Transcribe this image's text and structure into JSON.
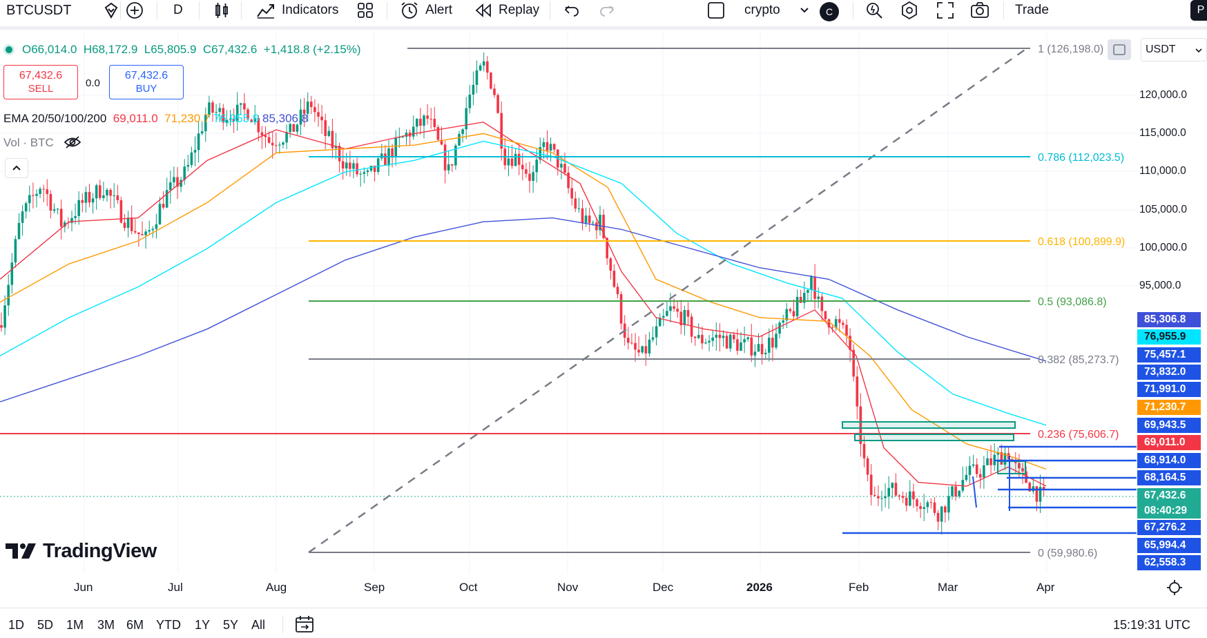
{
  "toolbar": {
    "symbol": "BTCUSDT",
    "interval": "D",
    "indicators_label": "Indicators",
    "alert_label": "Alert",
    "replay_label": "Replay",
    "layout_name": "crypto",
    "avatar_letter": "C",
    "trade_label": "Trade",
    "profile_letter": "P"
  },
  "legend": {
    "open": "O66,014.0",
    "high": "H68,172.9",
    "low": "L65,805.9",
    "close": "C67,432.6",
    "change": "+1,418.8 (+2.15%)",
    "sell_price": "67,432.6",
    "sell_label": "SELL",
    "spread": "0.0",
    "buy_price": "67,432.6",
    "buy_label": "BUY",
    "ema_title": "EMA 20/50/100/200",
    "ema20": "69,011.0",
    "ema50": "71,230.7",
    "ema100": "76,955.9",
    "ema200": "85,306.8",
    "vol_label": "Vol · BTC"
  },
  "currency": "USDT",
  "price_axis": [
    "120,000.0",
    "115,000.0",
    "110,000.0",
    "105,000.0",
    "100,000.0",
    "95,000.0"
  ],
  "price_tags": [
    {
      "value": "85,306.8",
      "color": "#3f51d8"
    },
    {
      "value": "76,955.9",
      "color": "#00e5ff",
      "text": "#131722"
    },
    {
      "value": "75,457.1",
      "color": "#1e53e5"
    },
    {
      "value": "73,832.0",
      "color": "#1e53e5"
    },
    {
      "value": "71,991.0",
      "color": "#1e53e5"
    },
    {
      "value": "71,230.7",
      "color": "#ff9800"
    },
    {
      "value": "69,943.5",
      "color": "#1e53e5"
    },
    {
      "value": "69,011.0",
      "color": "#f23645"
    },
    {
      "value": "68,914.0",
      "color": "#1e53e5"
    },
    {
      "value": "68,164.5",
      "color": "#1e53e5"
    },
    {
      "value": "67,432.6",
      "color": "#22ab94"
    },
    {
      "value": "08:40:29",
      "color": "#22ab94"
    },
    {
      "value": "67,276.2",
      "color": "#1e53e5"
    },
    {
      "value": "65,994.4",
      "color": "#1e53e5"
    },
    {
      "value": "62,558.3",
      "color": "#1e53e5"
    }
  ],
  "fib_levels": [
    {
      "label": "1 (126,198.0)",
      "color": "#787b86"
    },
    {
      "label": "0.786 (112,023.5)",
      "color": "#00bcd4"
    },
    {
      "label": "0.618 (100,899.9)",
      "color": "#ffb300"
    },
    {
      "label": "0.5 (93,086.8)",
      "color": "#43a047"
    },
    {
      "label": "0.382 (85,273.7)",
      "color": "#787b86"
    },
    {
      "label": "0.236 (75,606.7)",
      "color": "#f23645"
    },
    {
      "label": "0 (59,980.6)",
      "color": "#787b86"
    }
  ],
  "time_axis": [
    "Jun",
    "Jul",
    "Aug",
    "Sep",
    "Oct",
    "Nov",
    "Dec",
    "2026",
    "Feb",
    "Mar",
    "Apr"
  ],
  "ranges": [
    "1D",
    "5D",
    "1M",
    "3M",
    "6M",
    "YTD",
    "1Y",
    "5Y",
    "All"
  ],
  "clock": "15:19:31 UTC",
  "logo_text": "TradingView"
}
